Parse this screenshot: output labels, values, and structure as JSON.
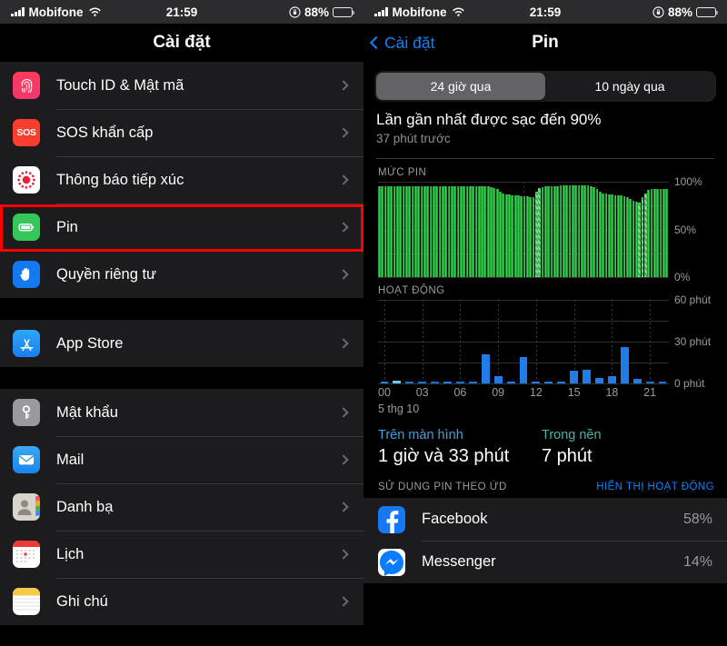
{
  "status_bar": {
    "carrier": "Mobifone",
    "time": "21:59",
    "battery_pct": "88%",
    "wifi_icon": "wifi-icon",
    "signal_icon": "cellular-bars-icon",
    "rotation_lock_icon": "rotation-lock-icon",
    "battery_icon": "battery-icon"
  },
  "left_screen": {
    "nav_title": "Cài đặt",
    "highlight_color": "#ff0000",
    "groups": [
      {
        "items": [
          {
            "label": "Touch ID & Mật mã",
            "icon": "fingerprint-icon",
            "highlighted": false
          },
          {
            "label": "SOS khẩn cấp",
            "icon": "sos-icon",
            "highlighted": false
          },
          {
            "label": "Thông báo tiếp xúc",
            "icon": "exposure-notification-icon",
            "highlighted": false
          },
          {
            "label": "Pin",
            "icon": "battery-icon",
            "highlighted": true
          },
          {
            "label": "Quyền riêng tư",
            "icon": "privacy-hand-icon",
            "highlighted": false
          }
        ]
      },
      {
        "items": [
          {
            "label": "App Store",
            "icon": "app-store-icon",
            "highlighted": false
          }
        ]
      },
      {
        "items": [
          {
            "label": "Mật khẩu",
            "icon": "key-icon",
            "highlighted": false
          },
          {
            "label": "Mail",
            "icon": "mail-icon",
            "highlighted": false
          },
          {
            "label": "Danh bạ",
            "icon": "contacts-icon",
            "highlighted": false
          },
          {
            "label": "Lịch",
            "icon": "calendar-icon",
            "highlighted": false
          },
          {
            "label": "Ghi chú",
            "icon": "notes-icon",
            "highlighted": false
          }
        ]
      }
    ]
  },
  "right_screen": {
    "nav_back_label": "Cài đặt",
    "nav_title": "Pin",
    "segments": [
      {
        "label": "24 giờ qua",
        "active": true
      },
      {
        "label": "10 ngày qua",
        "active": false
      }
    ],
    "last_charge_title": "Lần gần nhất được sạc đến 90%",
    "last_charge_sub": "37 phút trước",
    "battery_section_label": "MỨC PIN",
    "activity_section_label": "HOẠT ĐỘNG",
    "date_label": "5 thg 10",
    "stats": [
      {
        "title": "Trên màn hình",
        "value": "1 giờ và 33 phút",
        "color": "#3f9fe0"
      },
      {
        "title": "Trong nền",
        "value": "7 phút",
        "color": "#4ab3a8"
      }
    ],
    "usage_header_left": "SỬ DỤNG PIN THEO ỨD",
    "usage_header_right": "HIỂN THỊ HOẠT ĐỘNG",
    "apps": [
      {
        "name": "Facebook",
        "pct": "58%",
        "icon": "facebook-icon"
      },
      {
        "name": "Messenger",
        "pct": "14%",
        "icon": "messenger-icon"
      }
    ]
  },
  "chart_data": [
    {
      "type": "bar",
      "title": "MỨC PIN",
      "xlabel": "",
      "ylabel": "",
      "ylim": [
        0,
        100
      ],
      "ytick_labels": [
        "100%",
        "50%",
        "0%"
      ],
      "yticks": [
        100,
        50,
        0
      ],
      "bar_color": "#31d24a",
      "grid": true,
      "values": [
        95,
        95,
        95,
        95,
        95,
        95,
        95,
        95,
        95,
        95,
        95,
        95,
        95,
        95,
        95,
        95,
        95,
        95,
        95,
        95,
        95,
        95,
        95,
        95,
        95,
        95,
        95,
        95,
        95,
        95,
        95,
        95,
        95,
        95,
        95,
        95,
        95,
        94,
        93,
        92,
        90,
        88,
        87,
        87,
        86,
        86,
        86,
        85,
        85,
        85,
        84,
        84,
        90,
        93,
        94,
        95,
        95,
        95,
        95,
        95,
        96,
        96,
        96,
        96,
        96,
        96,
        96,
        96,
        96,
        96,
        95,
        94,
        92,
        90,
        88,
        88,
        87,
        87,
        86,
        86,
        86,
        85,
        84,
        82,
        80,
        79,
        78,
        84,
        88,
        91,
        92,
        92,
        92,
        92,
        92,
        92
      ],
      "charging_indices": [
        52,
        53,
        86,
        87,
        88
      ],
      "notes": "Battery level over last 24 hours; hatched bars indicate charging periods"
    },
    {
      "type": "bar",
      "title": "HOẠT ĐỘNG",
      "xlabel": "",
      "ylabel": "",
      "ylim": [
        0,
        60
      ],
      "ytick_labels": [
        "60 phút",
        "30 phút",
        "0 phút"
      ],
      "yticks": [
        60,
        30,
        0
      ],
      "bar_color": "#1f7ce8",
      "grid": true,
      "date_label": "5 thg 10",
      "xtick_labels": [
        "00",
        "03",
        "06",
        "09",
        "12",
        "15",
        "18",
        "21"
      ],
      "categories": [
        "00",
        "01",
        "02",
        "03",
        "04",
        "05",
        "06",
        "07",
        "08",
        "09",
        "10",
        "11",
        "12",
        "13",
        "14",
        "15",
        "16",
        "17",
        "18",
        "19",
        "20",
        "21",
        "22"
      ],
      "values": [
        1.5,
        2,
        0,
        0,
        0,
        1.5,
        0,
        0,
        21,
        5,
        1,
        19,
        1,
        1.2,
        1.2,
        9,
        10,
        4,
        5,
        26,
        3,
        0,
        0
      ],
      "light_bar_indices": [
        1
      ],
      "notes": "Screen activity minutes per hour; lighter bar indicates background activity"
    }
  ]
}
